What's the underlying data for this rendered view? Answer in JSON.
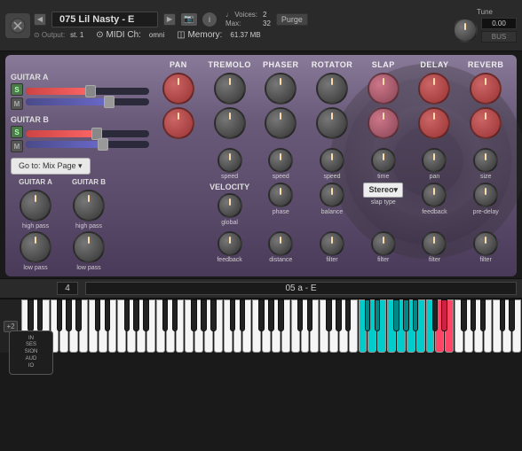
{
  "header": {
    "logo_icon": "♪",
    "preset_name": "075 Lil Nasty - E",
    "output_label": "⊙ Output:",
    "output_value": "st. 1",
    "voices_label": "♩ Voices:",
    "voices_value": "2",
    "max_label": "Max:",
    "max_value": "32",
    "purge_label": "Purge",
    "midi_label": "⊙ MIDI Ch:",
    "midi_value": "omni",
    "memory_label": "◫ Memory:",
    "memory_value": "61.37 MB",
    "tune_label": "Tune",
    "tune_value": "0.00",
    "bus_label": "BUS"
  },
  "fx_columns": [
    "PAN",
    "TREMOLO",
    "PHASER",
    "ROTATOR",
    "SLAP",
    "DELAY",
    "REVERB"
  ],
  "guitar_a": {
    "label": "GUITAR A",
    "s_label": "S",
    "m_label": "M"
  },
  "guitar_b": {
    "label": "GUITAR B",
    "s_label": "S",
    "m_label": "M"
  },
  "controls": {
    "go_to_mix": "Go to: Mix Page ▾",
    "guitar_a_col1": "high pass",
    "guitar_a_col2": "low pass",
    "guitar_b_col1": "high pass",
    "guitar_b_col2": "low pass",
    "velocity_label": "VELOCITY",
    "velocity_sub": "global",
    "tremolo_speed": "speed",
    "tremolo_phase": "phase",
    "tremolo_feedback": "feedback",
    "phaser_speed": "speed",
    "phaser_balance": "balance",
    "phaser_distance": "distance",
    "rotator_speed": "speed",
    "rotator_filter": "filter",
    "slap_time": "time",
    "slap_type": "slap type",
    "slap_filter": "filter",
    "delay_pan": "pan",
    "delay_feedback": "feedback",
    "delay_filter": "filter",
    "reverb_size": "size",
    "reverb_predelay": "pre-delay",
    "reverb_filter": "filter",
    "stereo_label": "Stereo▾"
  },
  "bottom_bar": {
    "page_num": "4",
    "preset_display": "05 a - E"
  },
  "piano": {
    "octave_label": "+2"
  }
}
